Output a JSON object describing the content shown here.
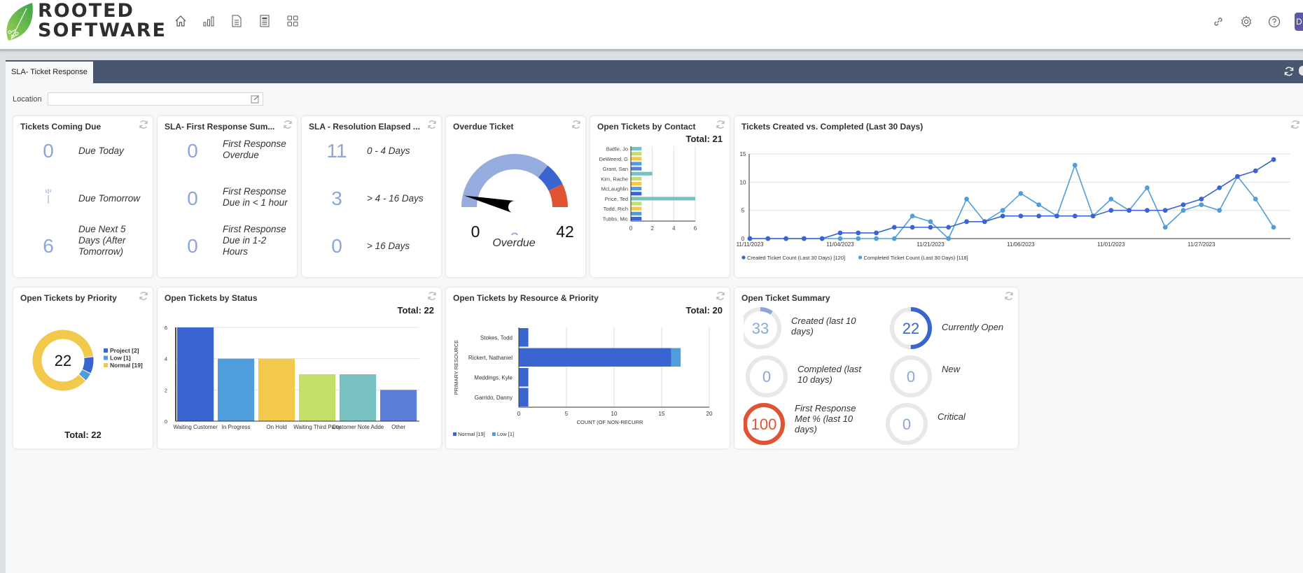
{
  "brand": {
    "line1": "ROOTED",
    "line2": "SOFTWARE"
  },
  "nav_icons": [
    "home-icon",
    "bar-chart-icon",
    "document-icon",
    "report-icon",
    "grid-icon"
  ],
  "header_right_icons": [
    "link-icon",
    "gear-icon",
    "help-icon"
  ],
  "avatar_initial": "D",
  "tabs": [
    {
      "label": "SLA- Ticket Response",
      "active": true
    }
  ],
  "filter": {
    "label": "Location",
    "value": ""
  },
  "widgets": {
    "coming_due": {
      "title": "Tickets Coming Due",
      "rows": [
        {
          "value": "0",
          "label": "Due Today"
        },
        {
          "value": "",
          "label": "Due Tomorrow"
        },
        {
          "value": "6",
          "label": "Due Next 5 Days (After Tomorrow)"
        }
      ]
    },
    "first_response": {
      "title": "SLA- First Response Sum...",
      "rows": [
        {
          "value": "0",
          "label": "First Response Overdue"
        },
        {
          "value": "0",
          "label": "First Response Due in < 1 hour"
        },
        {
          "value": "0",
          "label": "First Response Due in 1-2 Hours"
        }
      ]
    },
    "resolution": {
      "title": "SLA - Resolution Elapsed ...",
      "rows": [
        {
          "value": "11",
          "label": "0 - 4 Days"
        },
        {
          "value": "3",
          "label": "> 4 - 16 Days"
        },
        {
          "value": "0",
          "label": "> 16 Days"
        }
      ]
    },
    "overdue": {
      "title": "Overdue Ticket",
      "min_label": "0",
      "max_label": "42",
      "value_label": "3",
      "caption": "Overdue"
    },
    "by_contact": {
      "title": "Open Tickets by Contact",
      "total_label": "Total:",
      "total": "21"
    },
    "created_completed": {
      "title": "Tickets Created vs. Completed (Last 30 Days)"
    },
    "by_priority": {
      "title": "Open Tickets by Priority",
      "center": "22",
      "total_label": "Total:",
      "total": "22"
    },
    "by_status": {
      "title": "Open Tickets by Status",
      "total_label": "Total:",
      "total": "22"
    },
    "by_resource": {
      "title": "Open Tickets by Resource & Priority",
      "total_label": "Total:",
      "total": "20"
    },
    "summary": {
      "title": "Open Ticket Summary",
      "items": [
        {
          "value": "33",
          "label": "Created (last 10 days)",
          "fill": 0.1,
          "color": "#8ca6d8"
        },
        {
          "value": "22",
          "label": "Currently Open",
          "fill": 0.5,
          "color": "#3a64d0"
        },
        {
          "value": "0",
          "label": "Completed (last 10 days)",
          "fill": 0,
          "color": "#8ca6d8"
        },
        {
          "value": "0",
          "label": "New",
          "fill": 0,
          "color": "#8ca6d8"
        },
        {
          "value": "100",
          "label": "First Response Met % (last 10 days)",
          "fill": 1,
          "color": "#e05433"
        },
        {
          "value": "0",
          "label": "Critical",
          "fill": 0,
          "color": "#8ca6d8"
        }
      ]
    }
  },
  "chart_data": [
    {
      "id": "overdue_gauge",
      "type": "gauge",
      "title": "Overdue Ticket",
      "min": 0,
      "max": 42,
      "value": 3,
      "bands": [
        {
          "from": 0,
          "to": 30,
          "color": "#97acde"
        },
        {
          "from": 30,
          "to": 36,
          "color": "#3a64d0"
        },
        {
          "from": 36,
          "to": 42,
          "color": "#e05433"
        }
      ]
    },
    {
      "id": "by_contact",
      "type": "bar",
      "orientation": "horizontal",
      "title": "Open Tickets by Contact",
      "categories": [
        "Battle, Jo",
        "",
        "DeWeerd, G",
        "",
        "Grant, San",
        "",
        "Kim, Rache",
        "",
        "McLaughlin",
        "",
        "Price, Ted",
        "",
        "Todd, Rich",
        "",
        "Tubbs, Mic"
      ],
      "values": [
        1,
        1,
        1,
        1,
        1,
        2,
        1,
        1,
        1,
        1,
        6,
        1,
        1,
        1,
        1
      ],
      "colors": [
        "#79c0c0",
        "#c3df66",
        "#f3c94c",
        "#4f9ddc",
        "#5b7fd6",
        "#79c0c0",
        "#c3df66",
        "#f3c94c",
        "#4f9ddc",
        "#3a64d0",
        "#79c0c0",
        "#c3df66",
        "#f3c94c",
        "#4f9ddc",
        "#3a64d0"
      ],
      "xticks": [
        0,
        2,
        4,
        6
      ],
      "xlim": [
        0,
        6
      ]
    },
    {
      "id": "created_completed",
      "type": "line",
      "title": "Tickets Created vs. Completed (Last 30 Days)",
      "x_tick_labels": [
        "11/11/2023",
        "11/04/2023",
        "11/21/2023",
        "11/06/2023",
        "11/01/2023",
        "11/27/2023"
      ],
      "x_tick_indices": [
        0,
        5,
        10,
        15,
        20,
        25
      ],
      "ylim": [
        0,
        15
      ],
      "yticks": [
        0,
        5,
        10,
        15
      ],
      "series": [
        {
          "name": "Created Ticket Count (Last 30 Days) [120]",
          "color": "#3a64d0",
          "values": [
            0,
            0,
            0,
            0,
            0,
            1,
            1,
            1,
            2,
            2,
            2,
            2,
            3,
            3,
            4,
            4,
            4,
            4,
            4,
            4,
            5,
            5,
            5,
            5,
            6,
            7,
            9,
            11,
            12,
            14
          ]
        },
        {
          "name": "Completed Ticket Count (Last 30 Days) [118]",
          "color": "#4f9ddc",
          "values": [
            0,
            0,
            0,
            0,
            0,
            0,
            0,
            0,
            0,
            4,
            3,
            0,
            7,
            3,
            5,
            8,
            6,
            4,
            13,
            4,
            7,
            5,
            9,
            2,
            5,
            6,
            5,
            11,
            7,
            2
          ]
        }
      ],
      "legend": "bottom-left"
    },
    {
      "id": "by_priority",
      "type": "pie",
      "donut": true,
      "title": "Open Tickets by Priority",
      "categories": [
        "Project [2]",
        "Low [1]",
        "Normal [19]"
      ],
      "values": [
        2,
        1,
        19
      ],
      "colors": [
        "#3a64d0",
        "#4f9ddc",
        "#f3c94c"
      ],
      "legend": "right"
    },
    {
      "id": "by_status",
      "type": "bar",
      "title": "Open Tickets by Status",
      "categories": [
        "Waiting Customer",
        "In Progress",
        "On Hold",
        "Waiting Third Party",
        "Customer Note Adde",
        "Other"
      ],
      "values": [
        6,
        4,
        4,
        3,
        3,
        2
      ],
      "colors": [
        "#3a64d0",
        "#4f9ddc",
        "#f3c94c",
        "#c3df66",
        "#79c0c0",
        "#5b7fd6"
      ],
      "ylim": [
        0,
        6
      ],
      "yticks": [
        0,
        2,
        4,
        6
      ]
    },
    {
      "id": "by_resource",
      "type": "bar",
      "orientation": "horizontal",
      "stacked": true,
      "title": "Open Tickets by Resource & Priority",
      "categories": [
        "Stokes, Todd",
        "Rickert, Nathaniel",
        "Meddings, Kyle",
        "Garrido, Danny"
      ],
      "series": [
        {
          "name": "Normal [19]",
          "color": "#3a64d0",
          "values": [
            1,
            16,
            1,
            1
          ]
        },
        {
          "name": "Low [1]",
          "color": "#4f9ddc",
          "values": [
            0,
            1,
            0,
            0
          ]
        }
      ],
      "xlabel": "COUNT (OF NON-RECURR",
      "ylabel": "PRIMARY RESOURCE",
      "xlim": [
        0,
        20
      ],
      "xticks": [
        0,
        5,
        10,
        15,
        20
      ],
      "legend": "bottom-left"
    }
  ]
}
